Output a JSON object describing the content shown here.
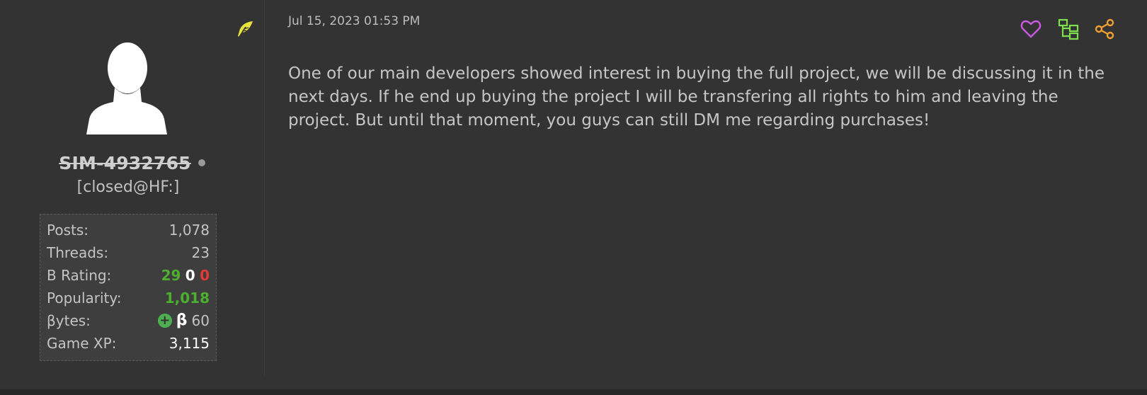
{
  "author": {
    "username": "SIM-4932765",
    "usertitle": "[closed@HF:]",
    "stats": {
      "posts_label": "Posts:",
      "posts_value": "1,078",
      "threads_label": "Threads:",
      "threads_value": "23",
      "rating_label": "B Rating:",
      "rating_positive": "29",
      "rating_neutral": "0",
      "rating_negative": "0",
      "popularity_label": "Popularity:",
      "popularity_value": "1,018",
      "bytes_label": "βytes:",
      "bytes_symbol": "β",
      "bytes_value": "60",
      "gamexp_label": "Game XP:",
      "gamexp_value": "3,115"
    }
  },
  "post": {
    "timestamp": "Jul 15, 2023 01:53 PM",
    "body": "One of our main developers showed interest in buying the full project, we will be discussing it in the next days. If he end up buying the project I will be transfering all rights to him and leaving the project. But until that moment, you guys can still DM me regarding purchases!"
  },
  "icons": {
    "feather": "feather-icon",
    "like": "heart-icon",
    "tree": "thread-tree-icon",
    "share": "share-icon"
  },
  "colors": {
    "background": "#333333",
    "rating_positive": "#4caf2f",
    "rating_negative": "#e53935",
    "heart": "#c75be0",
    "tree": "#7ee04a",
    "share": "#f0a030",
    "feather": "#e8e23c"
  }
}
